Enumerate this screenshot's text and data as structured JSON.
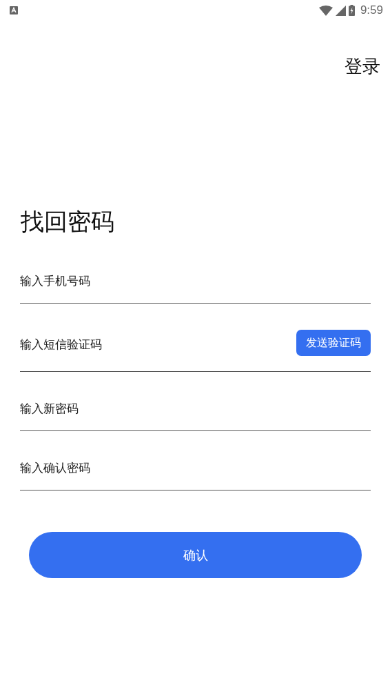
{
  "status_bar": {
    "time": "9:59"
  },
  "top_link": "登录",
  "title": "找回密码",
  "fields": [
    {
      "kind": "plain",
      "placeholder": "输入手机号码"
    },
    {
      "kind": "with_button",
      "placeholder": "输入短信验证码",
      "button": "发送验证码"
    },
    {
      "kind": "plain",
      "placeholder": "输入新密码"
    },
    {
      "kind": "plain",
      "placeholder": "输入确认密码"
    }
  ],
  "submit": "确认"
}
